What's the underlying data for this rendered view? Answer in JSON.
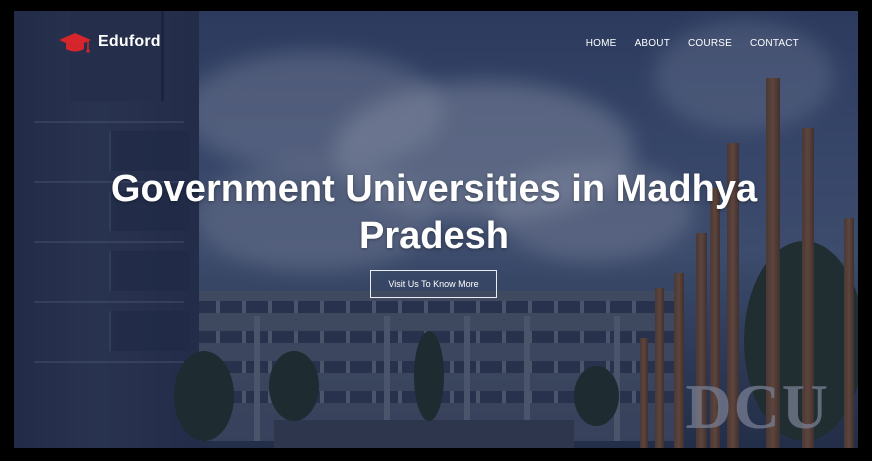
{
  "brand": {
    "name": "Eduford",
    "logo_icon": "graduation-cap-icon",
    "logo_color": "#d6262b"
  },
  "nav": {
    "items": [
      {
        "label": "HOME"
      },
      {
        "label": "ABOUT"
      },
      {
        "label": "COURSE"
      },
      {
        "label": "CONTACT"
      }
    ]
  },
  "hero": {
    "title": "Government Universities in Madhya Pradesh",
    "cta_label": "Visit Us To Know More"
  },
  "background": {
    "sign_text": "DCU"
  }
}
